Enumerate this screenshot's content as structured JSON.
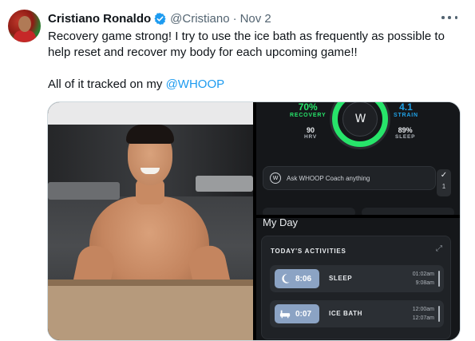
{
  "author": {
    "name": "Cristiano Ronaldo",
    "handle": "@Cristiano",
    "separator": "·",
    "date": "Nov 2"
  },
  "tweet": {
    "line1": "Recovery game strong! I try to use the ice bath as frequently as possible to",
    "line2": "help reset and recover my body for each upcoming game!!",
    "line3_prefix": "All of it tracked on my ",
    "mention": "@WHOOP"
  },
  "whoop_top": {
    "recovery_value": "70%",
    "recovery_label": "RECOVERY",
    "strain_value": "4.1",
    "strain_label": "STRAIN",
    "hrv_value": "90",
    "hrv_label": "HRV",
    "sleep_value": "89%",
    "sleep_label": "SLEEP",
    "logo": "W",
    "coach_badge": "W",
    "coach_text": "Ask WHOOP Coach anything",
    "check_count": "1"
  },
  "whoop_bottom": {
    "title": "My Day",
    "panel_title": "TODAY'S ACTIVITIES",
    "activities": [
      {
        "duration": "8:06",
        "name": "SLEEP",
        "start": "01:02am",
        "end": "9:08am",
        "icon": "moon-icon"
      },
      {
        "duration": "0:07",
        "name": "ICE BATH",
        "start": "12:00am",
        "end": "12:07am",
        "icon": "bathtub-icon"
      }
    ]
  },
  "colors": {
    "verified": "#1d9bf0",
    "mention": "#1d9bf0",
    "recovery_green": "#27e46a",
    "strain_blue": "#1fa1e6",
    "activity_pill": "#8ba3c4"
  }
}
